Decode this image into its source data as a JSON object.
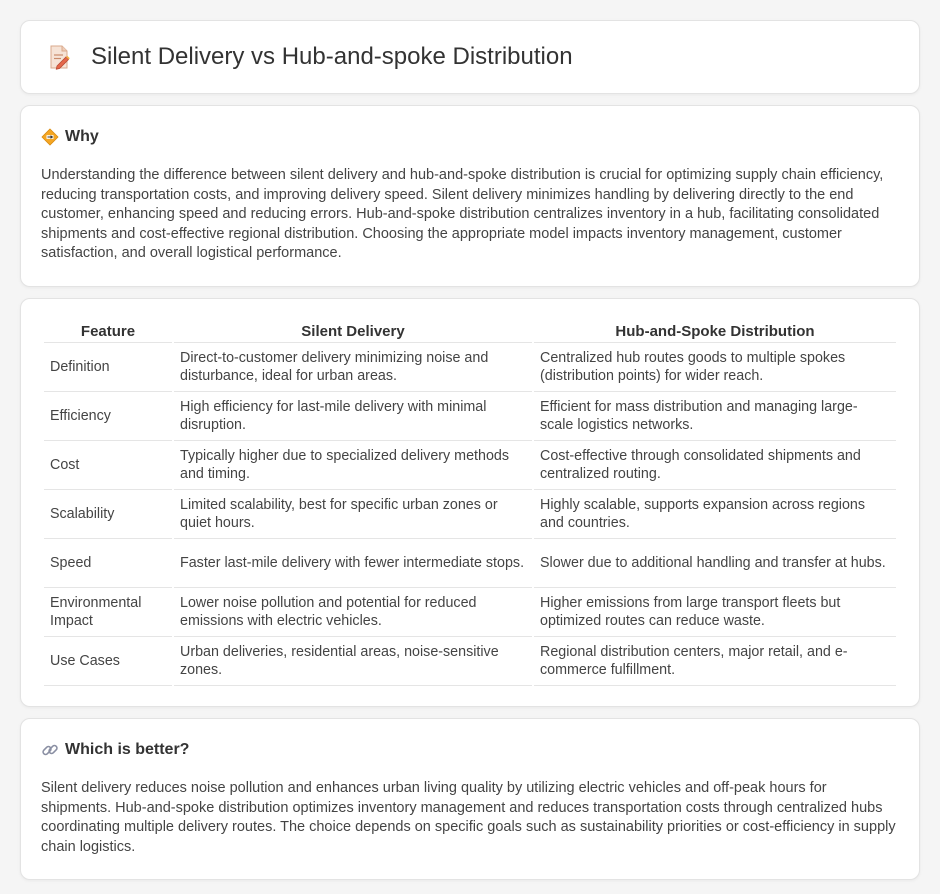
{
  "page": {
    "title": "Silent Delivery vs Hub-and-spoke Distribution",
    "title_icon": "document-pencil-icon"
  },
  "why": {
    "icon": "warning-diamond-icon",
    "heading": "Why",
    "text": "Understanding the difference between silent delivery and hub-and-spoke distribution is crucial for optimizing supply chain efficiency, reducing transportation costs, and improving delivery speed. Silent delivery minimizes handling by delivering directly to the end customer, enhancing speed and reducing errors. Hub-and-spoke distribution centralizes inventory in a hub, facilitating consolidated shipments and cost-effective regional distribution. Choosing the appropriate model impacts inventory management, customer satisfaction, and overall logistical performance."
  },
  "table": {
    "headers": [
      "Feature",
      "Silent Delivery",
      "Hub-and-Spoke Distribution"
    ],
    "rows": [
      [
        "Definition",
        "Direct-to-customer delivery minimizing noise and disturbance, ideal for urban areas.",
        "Centralized hub routes goods to multiple spokes (distribution points) for wider reach."
      ],
      [
        "Efficiency",
        "High efficiency for last-mile delivery with minimal disruption.",
        "Efficient for mass distribution and managing large-scale logistics networks."
      ],
      [
        "Cost",
        "Typically higher due to specialized delivery methods and timing.",
        "Cost-effective through consolidated shipments and centralized routing."
      ],
      [
        "Scalability",
        "Limited scalability, best for specific urban zones or quiet hours.",
        "Highly scalable, supports expansion across regions and countries."
      ],
      [
        "Speed",
        "Faster last-mile delivery with fewer intermediate stops.",
        "Slower due to additional handling and transfer at hubs."
      ],
      [
        "Environmental Impact",
        "Lower noise pollution and potential for reduced emissions with electric vehicles.",
        "Higher emissions from large transport fleets but optimized routes can reduce waste."
      ],
      [
        "Use Cases",
        "Urban deliveries, residential areas, noise-sensitive zones.",
        "Regional distribution centers, major retail, and e-commerce fulfillment."
      ]
    ]
  },
  "better": {
    "icon": "link-icon",
    "heading": "Which is better?",
    "text": "Silent delivery reduces noise pollution and enhances urban living quality by utilizing electric vehicles and off-peak hours for shipments. Hub-and-spoke distribution optimizes inventory management and reduces transportation costs through centralized hubs coordinating multiple delivery routes. The choice depends on specific goals such as sustainability priorities or cost-efficiency in supply chain logistics."
  }
}
